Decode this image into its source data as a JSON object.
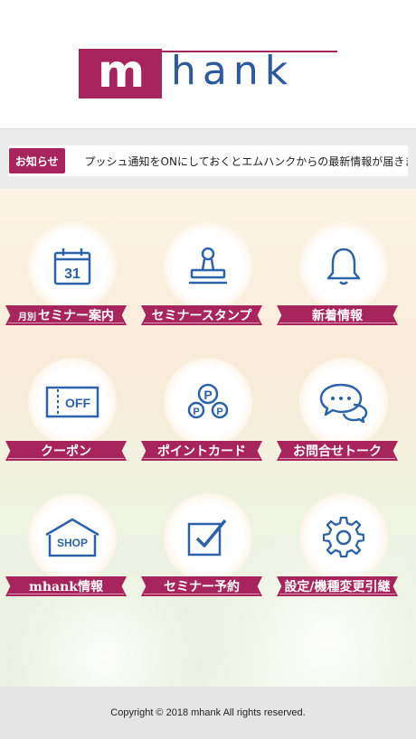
{
  "brand": {
    "logo_m": "m",
    "logo_rest": "hank",
    "primary_color": "#a8245c",
    "secondary_color": "#2c5a9c"
  },
  "notice": {
    "badge": "お知らせ",
    "text": "プッシュ通知をONにしておくとエムハンクからの最新情報が届きます"
  },
  "menu": [
    {
      "label": "セミナー案内",
      "prefix": "月別",
      "icon": "calendar-icon",
      "icon_text": "31"
    },
    {
      "label": "セミナースタンプ",
      "icon": "stamp-icon"
    },
    {
      "label": "新着情報",
      "icon": "bell-icon"
    },
    {
      "label": "クーポン",
      "icon": "coupon-icon",
      "icon_text": "OFF"
    },
    {
      "label": "ポイントカード",
      "icon": "points-icon",
      "icon_text": "P"
    },
    {
      "label": "お問合せトーク",
      "icon": "chat-icon"
    },
    {
      "label": "mhank情報",
      "icon": "shop-icon",
      "icon_text": "SHOP"
    },
    {
      "label": "セミナー予約",
      "icon": "checkbox-icon"
    },
    {
      "label": "設定/機種変更引継",
      "icon": "gear-icon"
    }
  ],
  "footer": {
    "copyright": "Copyright © 2018 mhank All rights reserved."
  }
}
